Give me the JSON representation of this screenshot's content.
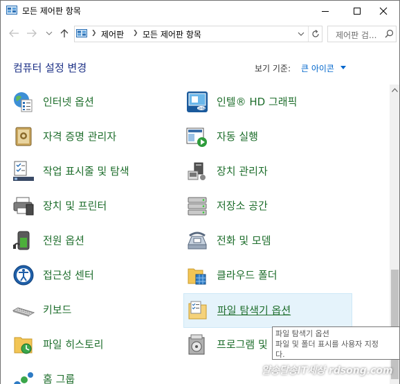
{
  "window": {
    "title": "모든 제어판 항목"
  },
  "address": {
    "crumbs": [
      "제어판",
      "모든 제어판 항목"
    ],
    "search_placeholder": "제어판 검..."
  },
  "header": {
    "title": "컴퓨터 설정 변경",
    "view_by_label": "보기 기준:",
    "view_by_value": "큰 아이콘"
  },
  "items": [
    {
      "label": "인터넷 옵션",
      "icon": "internet-options-icon"
    },
    {
      "label": "인텔® HD 그래픽",
      "icon": "intel-graphics-icon"
    },
    {
      "label": "자격 증명 관리자",
      "icon": "credential-manager-icon"
    },
    {
      "label": "자동 실행",
      "icon": "autoplay-icon"
    },
    {
      "label": "작업 표시줄 및 탐색",
      "icon": "taskbar-icon"
    },
    {
      "label": "장치 관리자",
      "icon": "device-manager-icon"
    },
    {
      "label": "장치 및 프린터",
      "icon": "devices-printers-icon"
    },
    {
      "label": "저장소 공간",
      "icon": "storage-spaces-icon"
    },
    {
      "label": "전원 옵션",
      "icon": "power-options-icon"
    },
    {
      "label": "전화 및 모뎀",
      "icon": "phone-modem-icon"
    },
    {
      "label": "접근성 센터",
      "icon": "ease-of-access-icon"
    },
    {
      "label": "클라우드 폴더",
      "icon": "cloud-folder-icon"
    },
    {
      "label": "키보드",
      "icon": "keyboard-icon"
    },
    {
      "label": "파일 탐색기 옵션",
      "icon": "file-explorer-options-icon"
    },
    {
      "label": "파일 히스토리",
      "icon": "file-history-icon"
    },
    {
      "label": "프로그램 및",
      "icon": "programs-features-icon"
    },
    {
      "label": "홈 그룹",
      "icon": "homegroup-icon"
    }
  ],
  "tooltip": {
    "line1": "파일 탐색기 옵션",
    "line2": "파일 및 폴더 표시를 사용자 지정",
    "line3": "다."
  },
  "watermark": "얄송달송IT세상 rdsong.com",
  "colors": {
    "link_green": "#1d6d2b",
    "title_blue": "#1e3287",
    "accent_blue": "#0066cc"
  }
}
